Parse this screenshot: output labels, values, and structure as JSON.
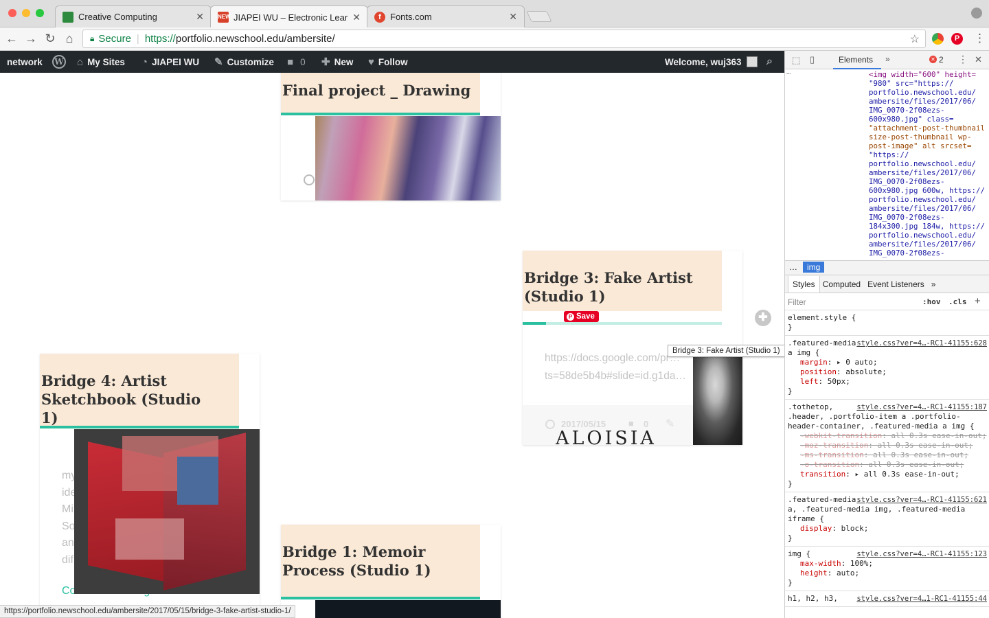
{
  "browser": {
    "tabs": [
      {
        "title": "Creative Computing",
        "favicon_color": "#2d8a3e"
      },
      {
        "title": "JIAPEI WU – Electronic Learnin",
        "favicon_color": "#d8412a"
      },
      {
        "title": "Fonts.com",
        "favicon_color": "#e0452e"
      }
    ],
    "secure_label": "Secure",
    "url_scheme": "https://",
    "url_rest": "portfolio.newschool.edu/ambersite/"
  },
  "adminbar": {
    "network": "network",
    "my_sites": "My Sites",
    "site_name": "JIAPEI WU",
    "customize": "Customize",
    "comments_count": "0",
    "new": "New",
    "follow": "Follow",
    "welcome": "Welcome, wuj363"
  },
  "page": {
    "cards": {
      "final": {
        "title": "Final project _ Drawing"
      },
      "bridge3": {
        "title": "Bridge 3: Fake Artist (Studio 1)",
        "link_text": "https://docs.google.com/pr…ts=58de5b4b#slide=id.g1da…",
        "date": "2017/05/15",
        "comments": "0",
        "save_label": "Save",
        "image_text": "ALOISIA"
      },
      "bridge4": {
        "title": "Bridge 4: Artist Sketchbook (Studio 1)",
        "excerpt_lines": [
          "my",
          "ide",
          "Mi",
          "So",
          "an",
          "dif"
        ],
        "continue": "Continue Reading"
      },
      "bridge1": {
        "title": "Bridge 1: Memoir Process (Studio 1)"
      }
    },
    "tooltip": "Bridge 3: Fake Artist (Studio 1)",
    "status_url": "https://portfolio.newschool.edu/ambersite/2017/05/15/bridge-3-fake-artist-studio-1/"
  },
  "devtools": {
    "tab_elements": "Elements",
    "error_count": "2",
    "breadcrumb_tail": "img",
    "style_tabs": [
      "Styles",
      "Computed",
      "Event Listeners"
    ],
    "filter_placeholder": "Filter",
    "hov": ":hov",
    "cls": ".cls",
    "source_lines": [
      "<img width=\"600\" height=",
      "\"980\" src=\"https://",
      "portfolio.newschool.edu/",
      "ambersite/files/2017/06/",
      "IMG_0070-2f08ezs-",
      "600x980.jpg\" class=",
      "\"attachment-post-thumbnail",
      "size-post-thumbnail wp-",
      "post-image\" alt srcset=",
      "\"https://",
      "portfolio.newschool.edu/",
      "ambersite/files/2017/06/",
      "IMG_0070-2f08ezs-",
      "600x980.jpg 600w, https://",
      "portfolio.newschool.edu/",
      "ambersite/files/2017/06/",
      "IMG_0070-2f08ezs-",
      "184x300.jpg 184w, https://",
      "portfolio.newschool.edu/",
      "ambersite/files/2017/06/",
      "IMG_0070-2f08ezs-"
    ],
    "rules": [
      {
        "selector": "element.style {",
        "source": "",
        "decls": []
      },
      {
        "selector": ".featured-media a img {",
        "source": "style.css?ver=4…-RC1-41155:628",
        "decls": [
          {
            "p": "margin",
            "v": "▸ 0 auto;",
            "s": false
          },
          {
            "p": "position",
            "v": "absolute;",
            "s": false
          },
          {
            "p": "left",
            "v": "50px;",
            "s": false
          }
        ]
      },
      {
        "selector": ".tothetop, .header, .portfolio-item a .portfolio-header-container, .featured-media a img {",
        "source": "style.css?ver=4…-RC1-41155:187",
        "decls": [
          {
            "p": "-webkit-transition",
            "v": "all 0.3s ease-in-out;",
            "s": true
          },
          {
            "p": "-moz-transition",
            "v": "all 0.3s ease-in-out;",
            "s": true
          },
          {
            "p": "-ms-transition",
            "v": "all 0.3s ease-in-out;",
            "s": true
          },
          {
            "p": "-o-transition",
            "v": "all 0.3s ease-in-out;",
            "s": true
          },
          {
            "p": "transition",
            "v": "▸ all 0.3s ease-in-out;",
            "s": false
          }
        ]
      },
      {
        "selector": ".featured-media a, .featured-media img, .featured-media iframe {",
        "source": "style.css?ver=4…-RC1-41155:621",
        "decls": [
          {
            "p": "display",
            "v": "block;",
            "s": false
          }
        ]
      },
      {
        "selector": "img {",
        "source": "style.css?ver=4…-RC1-41155:123",
        "decls": [
          {
            "p": "max-width",
            "v": "100%;",
            "s": false
          },
          {
            "p": "height",
            "v": "auto;",
            "s": false
          }
        ]
      },
      {
        "selector": "h1, h2, h3,",
        "source": "style.css?ver=4…1-RC1-41155:44",
        "decls": []
      }
    ]
  }
}
